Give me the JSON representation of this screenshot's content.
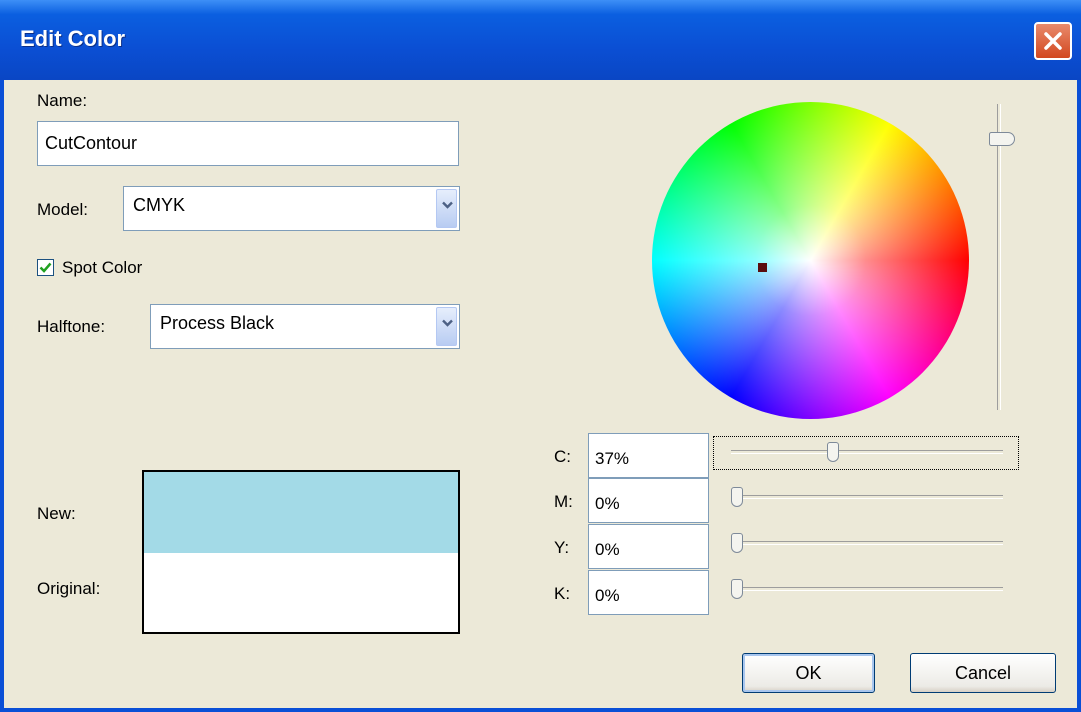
{
  "window": {
    "title": "Edit Color"
  },
  "name": {
    "label": "Name:",
    "value": "CutContour"
  },
  "model": {
    "label": "Model:",
    "value": "CMYK"
  },
  "spot_color": {
    "label": "Spot Color",
    "checked": true
  },
  "halftone": {
    "label": "Halftone:",
    "value": "Process Black"
  },
  "preview": {
    "new_label": "New:",
    "original_label": "Original:",
    "new_color": "#a3dae7",
    "original_color": "#ffffff"
  },
  "channels": [
    {
      "label": "C:",
      "value": "37%",
      "percent": 37
    },
    {
      "label": "M:",
      "value": "0%",
      "percent": 0
    },
    {
      "label": "Y:",
      "value": "0%",
      "percent": 0
    },
    {
      "label": "K:",
      "value": "0%",
      "percent": 0
    }
  ],
  "buttons": {
    "ok": "OK",
    "cancel": "Cancel"
  },
  "colors": {
    "title_bar": "#0b4fd4",
    "dialog_bg": "#ece9d8",
    "close": "#d2481f"
  }
}
